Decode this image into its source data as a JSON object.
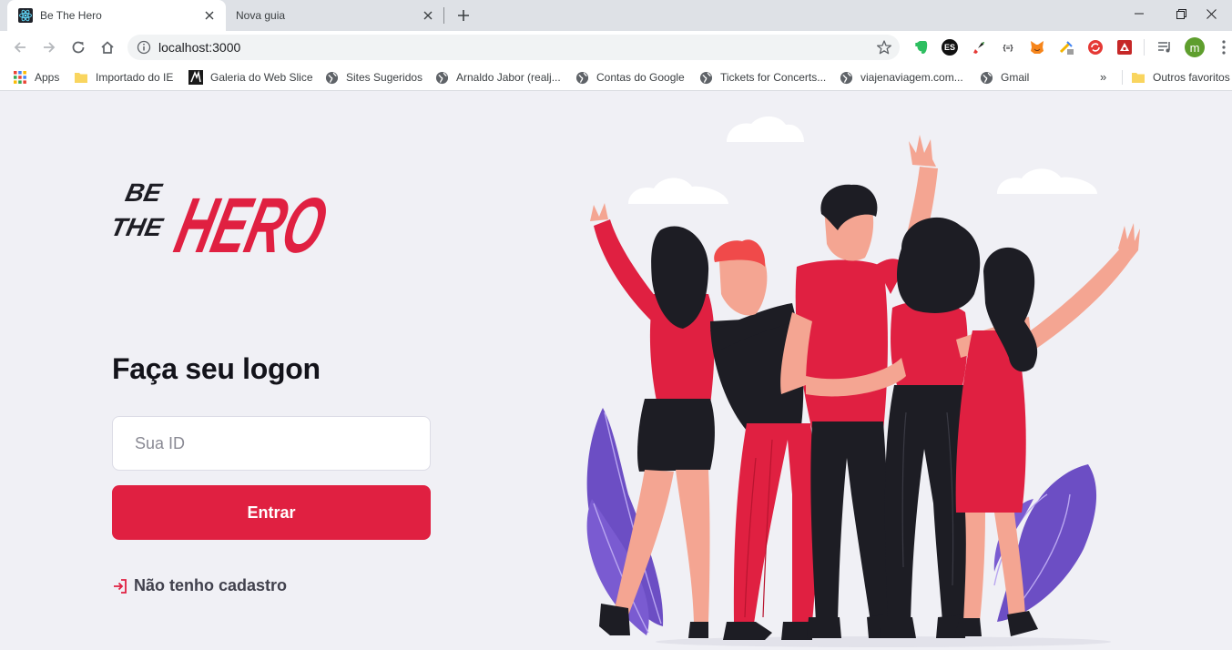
{
  "browser": {
    "tabs": [
      {
        "title": "Be The Hero",
        "active": true
      },
      {
        "title": "Nova guia",
        "active": false
      }
    ],
    "url": "localhost:3000",
    "profile_initial": "m",
    "extensions": [
      "evernote-icon",
      "es-icon",
      "ext-rocket-icon",
      "json-formatter-icon",
      "metamask-icon",
      "ext-pin-icon",
      "ext-sync-icon",
      "ext-red-icon"
    ],
    "ext_es_label": "ES",
    "ext_json_label": "{≡}"
  },
  "bookmarks": {
    "items": [
      {
        "label": "Apps",
        "icon": "apps-grid-icon"
      },
      {
        "label": "Importado do IE",
        "icon": "folder-icon"
      },
      {
        "label": "Galeria do Web Slice",
        "icon": "webslice-icon"
      },
      {
        "label": "Sites Sugeridos",
        "icon": "globe-icon"
      },
      {
        "label": "Arnaldo Jabor (realj...",
        "icon": "globe-icon"
      },
      {
        "label": "Contas do Google",
        "icon": "globe-icon"
      },
      {
        "label": "Tickets for Concerts...",
        "icon": "globe-icon"
      },
      {
        "label": "viajenaviagem.com...",
        "icon": "globe-icon"
      },
      {
        "label": "Gmail",
        "icon": "globe-icon"
      }
    ],
    "more_label": "»",
    "other": {
      "label": "Outros favoritos",
      "icon": "folder-icon"
    }
  },
  "logon": {
    "logo_text_small": [
      "BE",
      "THE"
    ],
    "logo_text_big": "HERO",
    "title": "Faça seu logon",
    "id_placeholder": "Sua ID",
    "id_value": "",
    "submit_label": "Entrar",
    "register_link": "Não tenho cadastro"
  },
  "colors": {
    "brand": "#e02041",
    "page_bg": "#f0f0f5",
    "text_dark": "#13131a",
    "text_muted": "#41414d"
  }
}
